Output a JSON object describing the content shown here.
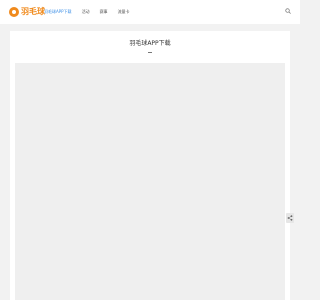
{
  "brand": {
    "name": "羽毛球"
  },
  "nav": {
    "items": [
      {
        "label": "羽毛球APP下载",
        "active": true
      },
      {
        "label": "活动",
        "active": false
      },
      {
        "label": "赛事",
        "active": false
      },
      {
        "label": "流量卡",
        "active": false
      }
    ]
  },
  "main": {
    "title": "羽毛球APP下载"
  },
  "icons": {
    "search": "search-icon",
    "share": "share-icon",
    "logo": "logo-icon"
  },
  "colors": {
    "brand": "#f08a1c",
    "active_nav": "#3a8ee6",
    "page_bg": "#f2f2f2"
  }
}
